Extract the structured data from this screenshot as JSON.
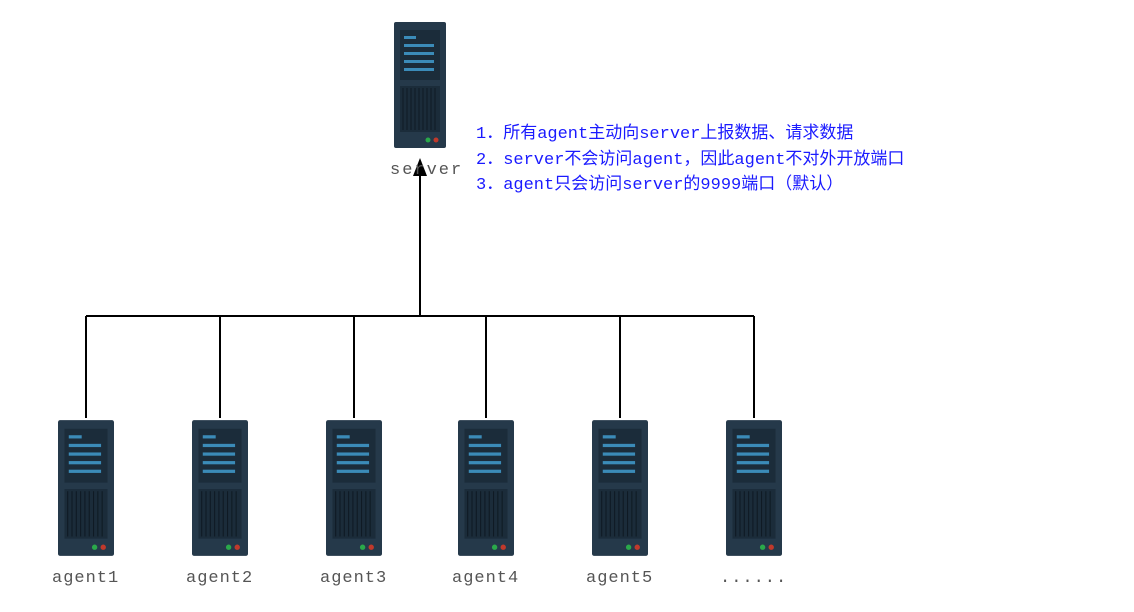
{
  "diagram": {
    "server": {
      "label": "server"
    },
    "agents": [
      {
        "label": "agent1"
      },
      {
        "label": "agent2"
      },
      {
        "label": "agent3"
      },
      {
        "label": "agent4"
      },
      {
        "label": "agent5"
      },
      {
        "label": "......"
      }
    ],
    "notes": {
      "line1": "1．所有agent主动向server上报数据、请求数据",
      "line2": "2．server不会访问agent，因此agent不对外开放端口",
      "line3": "3．agent只会访问server的9999端口（默认）"
    }
  }
}
